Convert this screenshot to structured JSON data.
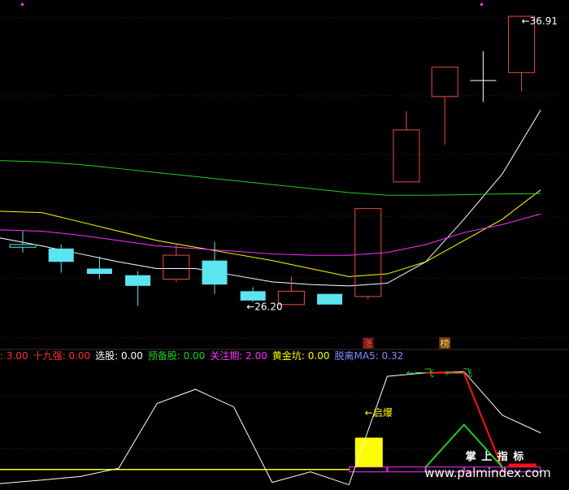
{
  "chart_data": [
    {
      "type": "candlestick",
      "panel": "price",
      "ylim": [
        24.6,
        37.4
      ],
      "candles": [
        {
          "open": 28.25,
          "close": 28.35,
          "high": 28.85,
          "low": 28.05,
          "color": "#5ce5f0"
        },
        {
          "open": 28.2,
          "close": 27.7,
          "high": 28.35,
          "low": 27.3,
          "color": "#5ce5f0"
        },
        {
          "open": 27.45,
          "close": 27.25,
          "high": 27.9,
          "low": 27.05,
          "color": "#5ce5f0"
        },
        {
          "open": 27.2,
          "close": 26.8,
          "high": 27.35,
          "low": 26.05,
          "color": "#5ce5f0"
        },
        {
          "open": 27.05,
          "close": 27.95,
          "high": 28.35,
          "low": 26.95,
          "color": "#e84b4b"
        },
        {
          "open": 27.75,
          "close": 26.85,
          "high": 28.45,
          "low": 26.5,
          "color": "#5ce5f0"
        },
        {
          "open": 26.6,
          "close": 26.25,
          "high": 26.75,
          "low": 26.2,
          "color": "#5ce5f0"
        },
        {
          "open": 26.1,
          "close": 26.6,
          "high": 27.15,
          "low": 26.1,
          "color": "#e84b4b"
        },
        {
          "open": 26.5,
          "close": 26.1,
          "high": 26.5,
          "low": 26.1,
          "color": "#5ce5f0"
        },
        {
          "open": 26.4,
          "close": 29.7,
          "high": 29.7,
          "low": 26.3,
          "color": "#e84b4b"
        },
        {
          "open": 30.7,
          "close": 32.65,
          "high": 33.35,
          "low": 30.7,
          "color": "#e84b4b"
        },
        {
          "open": 33.9,
          "close": 35.0,
          "high": 35.0,
          "low": 32.1,
          "color": "#e84b4b"
        },
        {
          "open": 34.5,
          "close": 34.5,
          "high": 35.6,
          "low": 33.7,
          "color": "#ffffff"
        },
        {
          "open": 34.8,
          "close": 36.91,
          "high": 36.91,
          "low": 34.1,
          "color": "#e84b4b"
        }
      ],
      "ma_lines": [
        {
          "color": "#ffffff",
          "points": [
            [
              -0.6,
              28.6
            ],
            [
              0.5,
              28.3
            ],
            [
              1.5,
              28.0
            ],
            [
              2.5,
              27.7
            ],
            [
              3.5,
              27.45
            ],
            [
              4.5,
              27.45
            ],
            [
              5.5,
              27.2
            ],
            [
              6.5,
              26.95
            ],
            [
              7.5,
              26.85
            ],
            [
              8.5,
              26.8
            ],
            [
              9.5,
              26.9
            ],
            [
              10.5,
              27.7
            ],
            [
              11.5,
              29.3
            ],
            [
              12.5,
              31.0
            ],
            [
              13.5,
              33.4
            ]
          ]
        },
        {
          "color": "#ffff00",
          "points": [
            [
              -0.6,
              29.6
            ],
            [
              0.5,
              29.55
            ],
            [
              1.5,
              29.2
            ],
            [
              2.5,
              28.85
            ],
            [
              3.5,
              28.5
            ],
            [
              4.5,
              28.25
            ],
            [
              5.5,
              28.0
            ],
            [
              6.5,
              27.75
            ],
            [
              7.5,
              27.45
            ],
            [
              8.5,
              27.15
            ],
            [
              9.5,
              27.25
            ],
            [
              10.5,
              27.7
            ],
            [
              11.5,
              28.5
            ],
            [
              12.5,
              29.3
            ],
            [
              13.5,
              30.4
            ]
          ]
        },
        {
          "color": "#ff33ff",
          "points": [
            [
              -0.6,
              28.9
            ],
            [
              0.5,
              28.85
            ],
            [
              1.5,
              28.7
            ],
            [
              2.5,
              28.5
            ],
            [
              3.5,
              28.3
            ],
            [
              4.5,
              28.2
            ],
            [
              5.5,
              28.1
            ],
            [
              6.5,
              28.0
            ],
            [
              7.5,
              27.95
            ],
            [
              8.5,
              27.95
            ],
            [
              9.5,
              28.05
            ],
            [
              10.5,
              28.35
            ],
            [
              11.5,
              28.8
            ],
            [
              12.5,
              29.1
            ],
            [
              13.5,
              29.5
            ]
          ]
        },
        {
          "color": "#22cc22",
          "points": [
            [
              -0.6,
              31.5
            ],
            [
              0.5,
              31.45
            ],
            [
              1.5,
              31.35
            ],
            [
              2.5,
              31.2
            ],
            [
              3.5,
              31.05
            ],
            [
              4.5,
              30.9
            ],
            [
              5.5,
              30.75
            ],
            [
              6.5,
              30.6
            ],
            [
              7.5,
              30.45
            ],
            [
              8.5,
              30.3
            ],
            [
              9.5,
              30.2
            ],
            [
              10.5,
              30.2
            ],
            [
              11.5,
              30.22
            ],
            [
              12.5,
              30.25
            ],
            [
              13.5,
              30.26
            ]
          ]
        }
      ],
      "annotations": [
        {
          "text": "36.91",
          "candle": 13,
          "value": 36.91,
          "color": "#ffffff"
        },
        {
          "text": "26.20",
          "candle": 6,
          "value": 26.2,
          "color": "#ffffff"
        }
      ],
      "markers": [
        {
          "text": "涨",
          "candle": 9,
          "color": "#ff5555",
          "bg": "#5a1010"
        },
        {
          "text": "榜",
          "candle": 11,
          "color": "#ffcc66",
          "bg": "#6a3a10"
        }
      ]
    },
    {
      "type": "indicator",
      "panel": "indicator",
      "ylim": [
        0,
        100
      ],
      "legend": [
        {
          "text": ": 3.00",
          "color": "#ff3333"
        },
        {
          "text": "十九强: 0.00",
          "color": "#ff3333"
        },
        {
          "text": "选股: 0.00",
          "color": "#ffffff"
        },
        {
          "text": "预备股: 0.00",
          "color": "#22cc22"
        },
        {
          "text": "关注期: 2.00",
          "color": "#ff33ff"
        },
        {
          "text": "黄金坑: 0.00",
          "color": "#ffff00"
        },
        {
          "text": "脱离MA5: 0.32",
          "color": "#8888ff"
        }
      ],
      "white_line": [
        [
          -0.6,
          2
        ],
        [
          0.5,
          5
        ],
        [
          1.5,
          8
        ],
        [
          2.5,
          15
        ],
        [
          3.5,
          70
        ],
        [
          4.5,
          82
        ],
        [
          5.5,
          67
        ],
        [
          6.5,
          3
        ],
        [
          7.5,
          12
        ],
        [
          8.5,
          1
        ],
        [
          9.5,
          93
        ],
        [
          10.5,
          96
        ],
        [
          11.5,
          97
        ],
        [
          12.5,
          60
        ],
        [
          13.5,
          45
        ]
      ],
      "red_line": [
        [
          10.5,
          96
        ],
        [
          11.5,
          96
        ],
        [
          12.5,
          15
        ]
      ],
      "green_line": [
        [
          10.5,
          16
        ],
        [
          11.5,
          52
        ],
        [
          12.5,
          16
        ]
      ],
      "yellow_level": 14,
      "yellow_bar": {
        "candle": 9,
        "value": 41
      },
      "bars": [
        {
          "candle": 9,
          "color": "#ff33ff"
        },
        {
          "candle": 10,
          "color": "#ff33ff"
        },
        {
          "candle": 11,
          "color": "#ff33ff"
        },
        {
          "candle": 12,
          "color": "#ff33ff"
        },
        {
          "candle": 13,
          "color": "#ff33ff"
        }
      ],
      "small_bars": [
        {
          "candle": 12,
          "value": 16,
          "color": "#ffffff"
        },
        {
          "candle": 13,
          "value": 19,
          "color": "#ff1111"
        }
      ],
      "annotations": [
        {
          "text": "启爆",
          "candle": 9,
          "value": 62,
          "color": "#ffff00"
        },
        {
          "text": "一飞",
          "candle": 10,
          "value": 96,
          "color": "#22cc22"
        },
        {
          "text": "一飞",
          "candle": 11,
          "value": 96,
          "color": "#22cc22"
        }
      ]
    }
  ],
  "watermark": {
    "cn": "掌 上 指 标",
    "url": "www.palmindex.com"
  }
}
